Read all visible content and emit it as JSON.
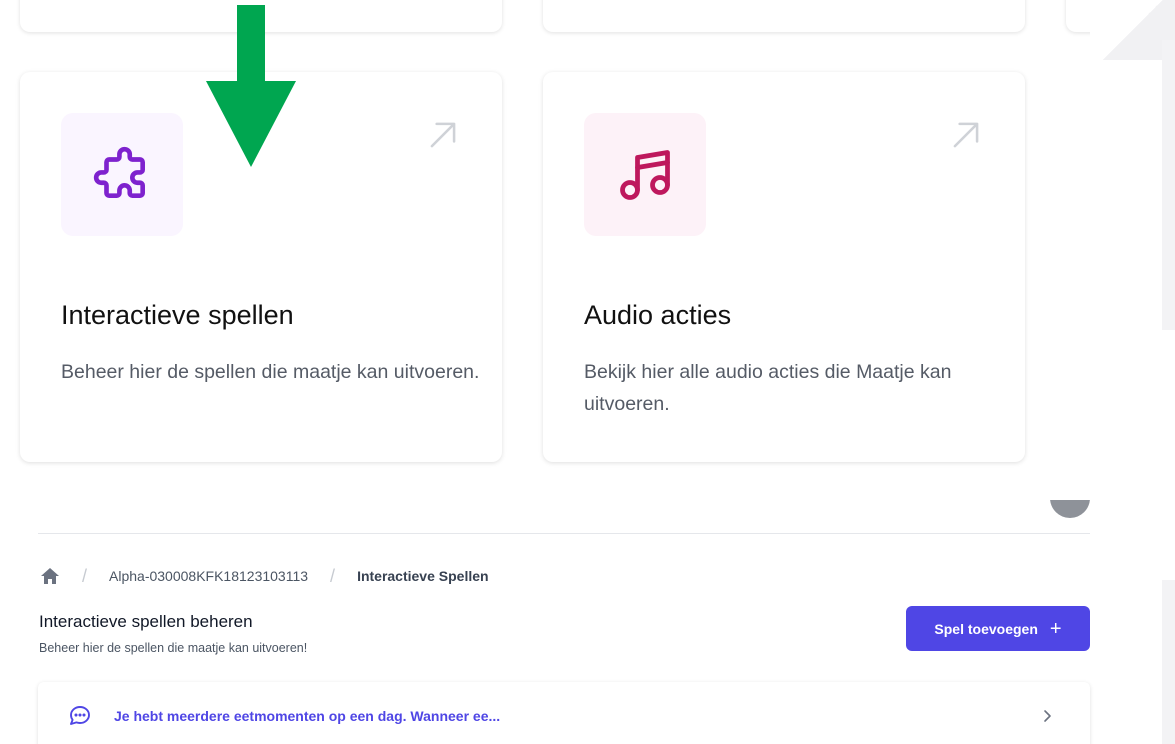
{
  "cards": [
    {
      "icon": "puzzle-icon",
      "title": "Interactieve spellen",
      "description": "Beheer hier de spellen die maatje kan uitvoeren.",
      "accent": "#7e22ce",
      "icon_bg": "#faf5ff"
    },
    {
      "icon": "music-note-icon",
      "title": "Audio acties",
      "description": "Bekijk hier alle audio acties die Maatje kan uitvoeren.",
      "accent": "#be185d",
      "icon_bg": "#fdf2f8"
    }
  ],
  "annotation": {
    "icon": "green-down-arrow",
    "color": "#00a650"
  },
  "breadcrumb": {
    "home_icon": "home-icon",
    "device": "Alpha-030008KFK18123103113",
    "current": "Interactieve Spellen"
  },
  "section": {
    "title": "Interactieve spellen beheren",
    "subtitle": "Beheer hier de spellen die maatje kan uitvoeren!",
    "add_button": "Spel toevoegen",
    "add_button_color": "#4f46e5"
  },
  "list": [
    {
      "icon": "chat-bubble-icon",
      "text": "Je hebt meerdere eetmomenten op een dag. Wanneer ee..."
    }
  ]
}
